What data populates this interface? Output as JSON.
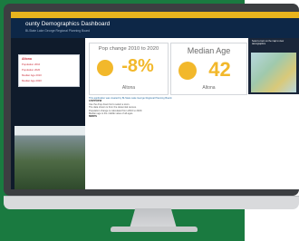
{
  "dashboard": {
    "title": "ounty Demographics Dashboard",
    "subtitle": "Bi-State Lake George Regional Planning Board"
  },
  "left_panel": {
    "title": "Altona",
    "lines": [
      "Population 2010",
      "Population 2020",
      "Median Age 2010",
      "Median Age 2020"
    ]
  },
  "cards": [
    {
      "label": "Pop change 2010 to 2020",
      "value": "-8%",
      "place": "Altona"
    },
    {
      "label": "Median Age",
      "value": "42",
      "place": "Altona"
    }
  ],
  "map": {
    "caption": "Select a town on the map to view demographics"
  },
  "text": {
    "intro": "This application was created by Bi-State Lake George Regional Planning Board.",
    "sections": [
      "Overview",
      "Notes"
    ],
    "paragraphs": [
      "Use the drop down list to select a town.",
      "The data shown is from the decennial census.",
      "Population change is calculated from 2010 to 2020.",
      "Median age is the middle value of all ages."
    ]
  },
  "colors": {
    "accent": "#f2b82b",
    "header": "#0d2747",
    "green": "#1a7a40"
  }
}
